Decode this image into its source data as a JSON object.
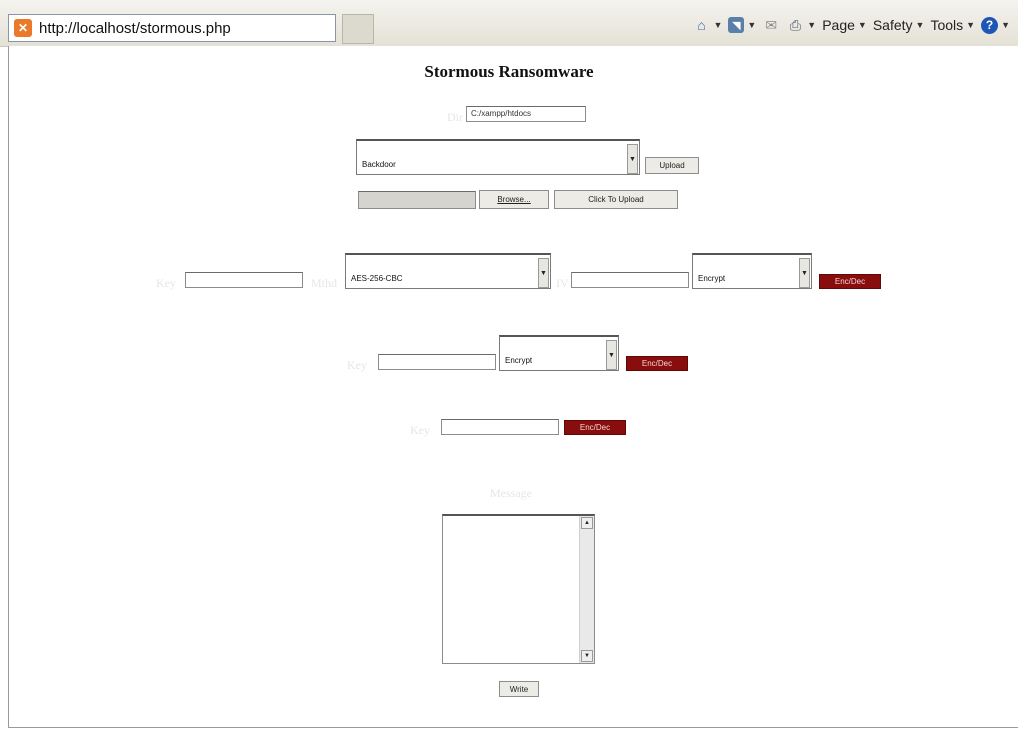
{
  "browser": {
    "url": "http://localhost/stormous.php",
    "favicon_glyph": "✕",
    "menu": {
      "page": "Page",
      "safety": "Safety",
      "tools": "Tools"
    },
    "icons": {
      "home": "home-icon",
      "feeds": "feeds-icon",
      "mail": "mail-icon",
      "print": "print-icon",
      "help": "help-icon"
    }
  },
  "page": {
    "title": "Stormous Ransomware",
    "upload": {
      "dir_label": "Dir",
      "dir_value": "C:/xampp/htdocs",
      "type_selected": "Backdoor",
      "upload_button": "Upload",
      "browse_button": "Browse...",
      "click_upload_button": "Click To Upload"
    },
    "cipher_row": {
      "key_label": "Key",
      "method_label": "Mthd",
      "method_selected": "AES-256-CBC",
      "iv_label": "IV",
      "mode_selected": "Encrypt",
      "button": "Enc/Dec"
    },
    "row2": {
      "key_label": "Key",
      "mode_selected": "Encrypt",
      "button": "Enc/Dec"
    },
    "row3": {
      "key_label": "Key",
      "button": "Enc/Dec"
    },
    "message": {
      "label": "Message",
      "write_button": "Write"
    }
  },
  "colors": {
    "accent_red": "#8a0d0d",
    "label_faint": "#e6e6e6"
  }
}
